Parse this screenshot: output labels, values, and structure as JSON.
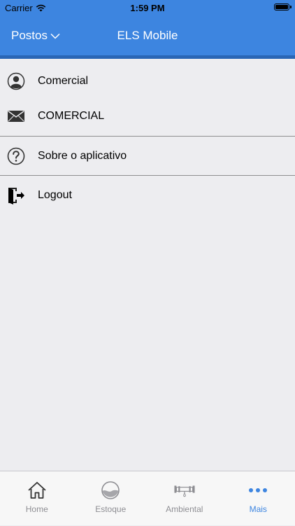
{
  "status_bar": {
    "carrier": "Carrier",
    "time": "1:59 PM"
  },
  "nav": {
    "postos_label": "Postos",
    "title": "ELS Mobile"
  },
  "menu": {
    "user_name": "Comercial",
    "user_email": "COMERCIAL",
    "about_label": "Sobre o aplicativo",
    "logout_label": "Logout"
  },
  "tabs": [
    {
      "label": "Home",
      "icon": "home-icon"
    },
    {
      "label": "Estoque",
      "icon": "tank-gauge-icon"
    },
    {
      "label": "Ambiental",
      "icon": "pipe-icon"
    },
    {
      "label": "Mais",
      "icon": "more-icon"
    }
  ],
  "colors": {
    "primary": "#3d85e0",
    "background": "#ededf0",
    "tab_inactive": "#8e8e93"
  }
}
